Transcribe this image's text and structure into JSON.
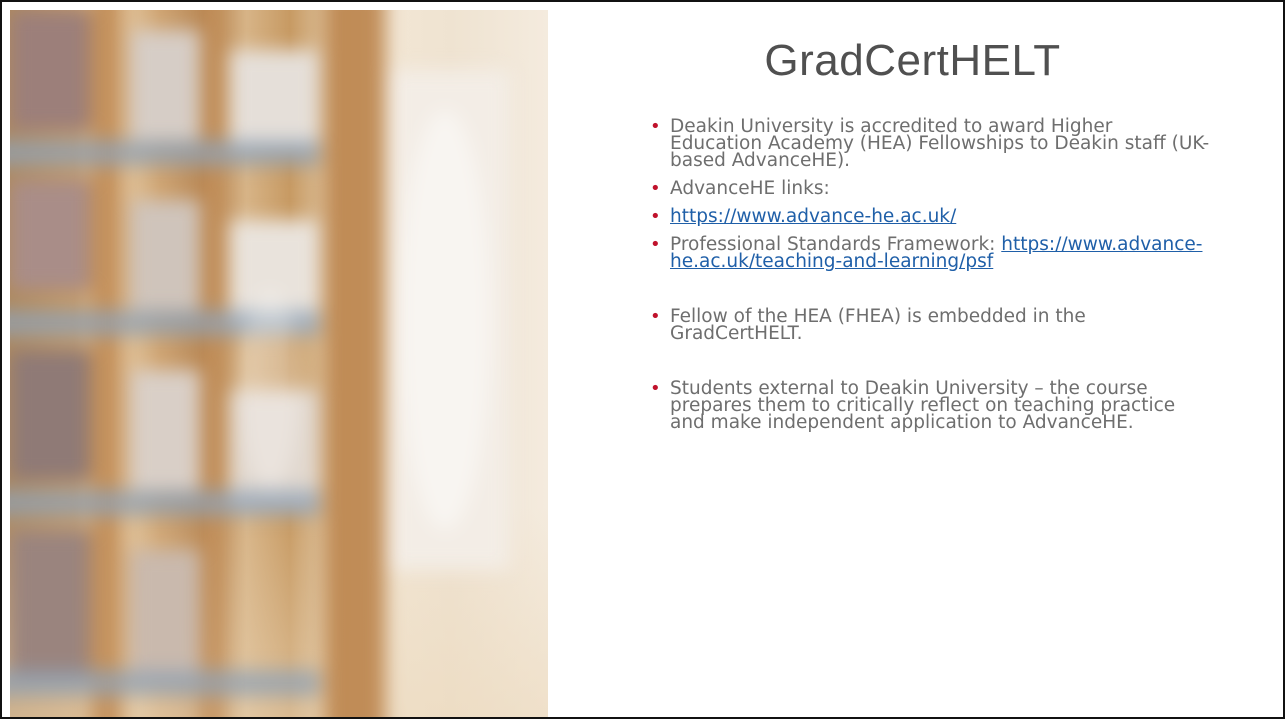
{
  "slide": {
    "title": "GradCertHELT",
    "bullets": [
      {
        "text": "Deakin University is accredited to award Higher Education Academy (HEA) Fellowships to Deakin staff (UK-based AdvanceHE)."
      },
      {
        "text": "AdvanceHE links:"
      },
      {
        "link": "https://www.advance-he.ac.uk/"
      },
      {
        "text": "Professional Standards Framework: ",
        "link": "https://www.advance-he.ac.uk/teaching-and-learning/psf"
      },
      {
        "text": "Fellow of the HEA (FHEA) is embedded in the GradCertHELT."
      },
      {
        "text": "Students external to Deakin University – the course prepares them to critically reflect on teaching practice and make independent application to AdvanceHE."
      }
    ]
  },
  "colors": {
    "bullet": "#c0122c",
    "link": "#1f5fa8",
    "body_text": "#6e6e6e",
    "title_text": "#505050"
  }
}
